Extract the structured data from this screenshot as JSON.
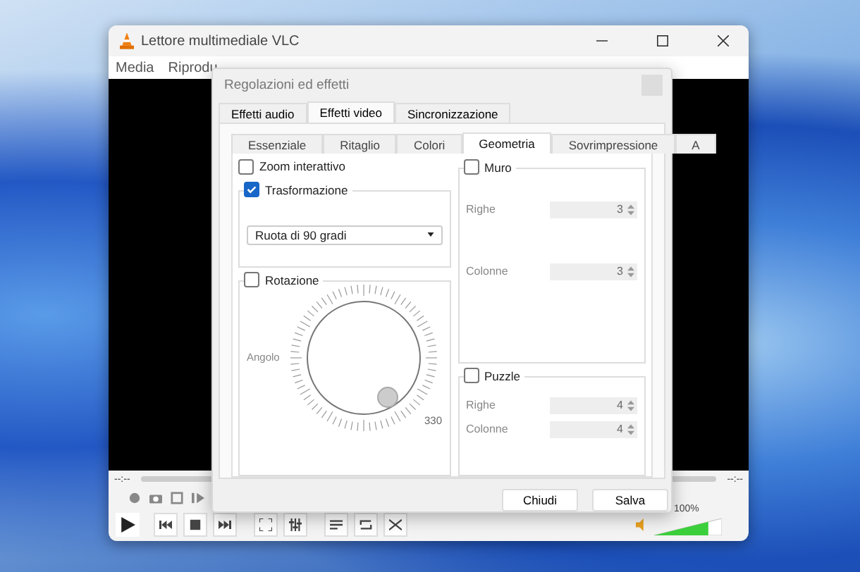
{
  "window": {
    "title": "Lettore multimediale VLC"
  },
  "menu": [
    "Media",
    "Riprodu"
  ],
  "player": {
    "elapsed": "--:--",
    "remaining": "--:--",
    "volume": {
      "reading": "100%",
      "level": 0.8
    }
  },
  "dialog": {
    "title": "Regolazioni ed effetti",
    "tabs": [
      {
        "label": "Effetti audio",
        "selected": false
      },
      {
        "label": "Effetti video",
        "selected": true
      },
      {
        "label": "Sincronizzazione",
        "selected": false
      }
    ],
    "subtabs": [
      {
        "label": "Essenziale",
        "selected": false
      },
      {
        "label": "Ritaglio",
        "selected": false
      },
      {
        "label": "Colori",
        "selected": false
      },
      {
        "label": "Geometria",
        "selected": true
      },
      {
        "label": "Sovrimpressione",
        "selected": false
      },
      {
        "label": "A",
        "selected": false
      }
    ],
    "zoom": {
      "label": "Zoom interattivo",
      "checked": false
    },
    "transform": {
      "label": "Trasformazione",
      "checked": true,
      "value": "Ruota di 90 gradi"
    },
    "rotation": {
      "label": "Rotazione",
      "checked": false,
      "angle_label": "Angolo",
      "dial_label": "330"
    },
    "wall": {
      "label": "Muro",
      "checked": false,
      "rows_label": "Righe",
      "rows": "3",
      "cols_label": "Colonne",
      "cols": "3"
    },
    "puzzle": {
      "label": "Puzzle",
      "checked": false,
      "rows_label": "Righe",
      "rows": "4",
      "cols_label": "Colonne",
      "cols": "4"
    },
    "buttons": [
      "Chiudi",
      "Salva"
    ]
  }
}
